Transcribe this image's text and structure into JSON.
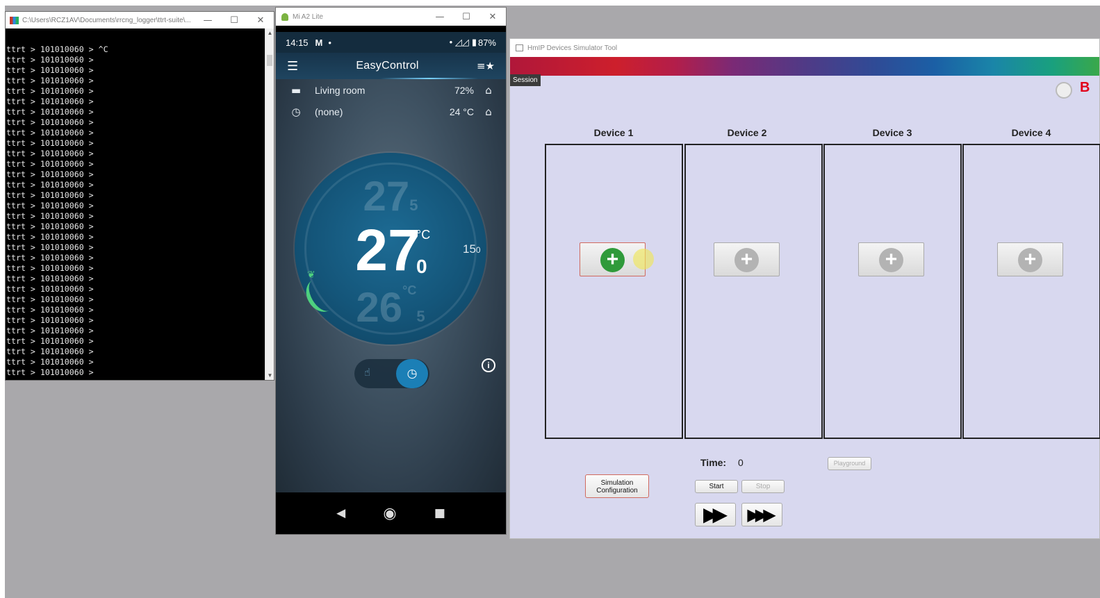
{
  "console": {
    "title": "C:\\Users\\RCZ1AV\\Documents\\rrcng_logger\\ttrt-suite\\...",
    "lines": [
      "ttrt > 101010060 > ^C",
      "ttrt > 101010060 >",
      "ttrt > 101010060 >",
      "ttrt > 101010060 >",
      "ttrt > 101010060 >",
      "ttrt > 101010060 >",
      "ttrt > 101010060 >",
      "ttrt > 101010060 >",
      "ttrt > 101010060 >",
      "ttrt > 101010060 >",
      "ttrt > 101010060 >",
      "ttrt > 101010060 >",
      "ttrt > 101010060 >",
      "ttrt > 101010060 >",
      "ttrt > 101010060 >",
      "ttrt > 101010060 >",
      "ttrt > 101010060 >",
      "ttrt > 101010060 >",
      "ttrt > 101010060 >",
      "ttrt > 101010060 >",
      "ttrt > 101010060 >",
      "ttrt > 101010060 >",
      "ttrt > 101010060 >",
      "ttrt > 101010060 >",
      "ttrt > 101010060 >",
      "ttrt > 101010060 >",
      "ttrt > 101010060 >",
      "ttrt > 101010060 >",
      "ttrt > 101010060 >",
      "ttrt > 101010060 >",
      "ttrt > 101010060 >",
      "ttrt > 101010060 >"
    ]
  },
  "phone": {
    "window_title": "Mi A2 Lite",
    "status": {
      "time": "14:15",
      "mail_icon": "M",
      "battery": "87%"
    },
    "app_title": "EasyControl",
    "room": {
      "name": "Living room",
      "humidity": "72%"
    },
    "schedule": {
      "name": "(none)",
      "outside_temp": "24 °C"
    },
    "dial": {
      "ghost_top": "27",
      "ghost_top_dec": "5",
      "current": "27",
      "current_unit": "°C",
      "current_dec": "0",
      "ghost_bottom": "26",
      "ghost_bottom_unit": "°C",
      "ghost_bottom_dec": "5",
      "side_value": "15",
      "side_dec": "0"
    }
  },
  "simulator": {
    "window_title": "HmIP Devices Simulator Tool",
    "session_tooltip": "Session",
    "corner_letter": "B",
    "devices": [
      {
        "label": "Device 1",
        "active": true
      },
      {
        "label": "Device 2",
        "active": false
      },
      {
        "label": "Device 3",
        "active": false
      },
      {
        "label": "Device 4",
        "active": false
      }
    ],
    "time_label": "Time:",
    "time_value": "0",
    "playground_label": "Playground",
    "sim_config_line1": "Simulation",
    "sim_config_line2": "Configuration",
    "start_label": "Start",
    "stop_label": "Stop",
    "ff_label": "▶▶",
    "fff_label": "▶▶▶"
  }
}
